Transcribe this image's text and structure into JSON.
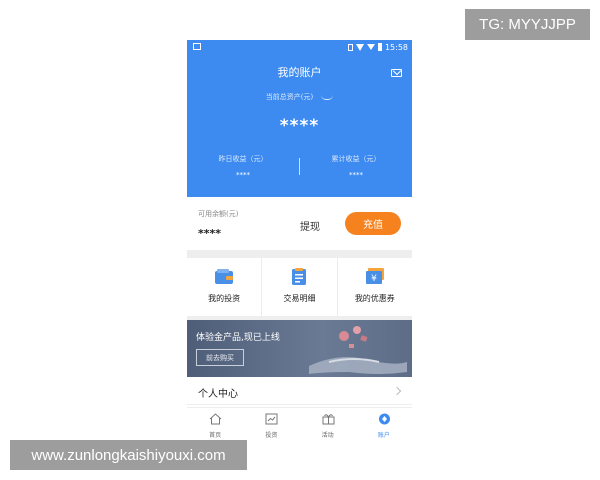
{
  "watermarks": {
    "tg": "TG: MYYJJPP",
    "url": "www.zunlongkaishiyouxi.com"
  },
  "status_bar": {
    "time": "15:58"
  },
  "header": {
    "title": "我的账户",
    "assets_label": "当前总资产(元)",
    "assets_value": "****",
    "yesterday_label": "昨日收益（元）",
    "yesterday_value": "****",
    "cumulative_label": "累计收益（元）",
    "cumulative_value": "****"
  },
  "balance": {
    "label": "可用余额(元)",
    "value": "****",
    "withdraw_label": "提现",
    "recharge_label": "充值"
  },
  "quick_links": [
    {
      "label": "我的投资",
      "icon": "wallet-icon"
    },
    {
      "label": "交易明细",
      "icon": "document-icon"
    },
    {
      "label": "我的优惠券",
      "icon": "coupon-icon"
    }
  ],
  "banner": {
    "title": "体验金产品,现已上线",
    "button_label": "前去购买"
  },
  "personal_center": {
    "label": "个人中心"
  },
  "tabbar": [
    {
      "label": "首页",
      "icon": "home-icon"
    },
    {
      "label": "投资",
      "icon": "chart-icon"
    },
    {
      "label": "活动",
      "icon": "gift-icon"
    },
    {
      "label": "账户",
      "icon": "account-icon",
      "active": true
    }
  ],
  "colors": {
    "primary": "#3d8bf0",
    "accent": "#f5821f"
  }
}
